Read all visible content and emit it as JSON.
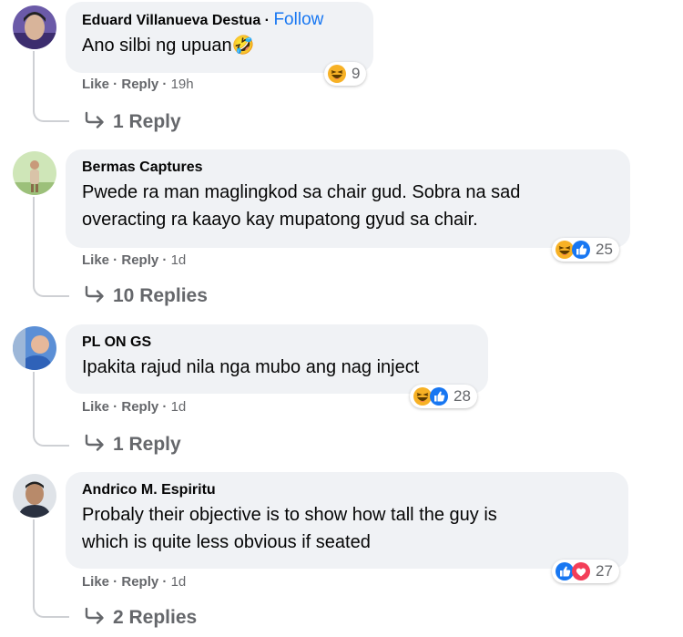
{
  "comments": [
    {
      "name": "Eduard Villanueva Destua",
      "separator": "·",
      "follow": "Follow",
      "text": "Ano silbi ng upuan🤣",
      "like": "Like",
      "reply": "Reply",
      "time": "19h",
      "reaction_icons": [
        "haha-icon"
      ],
      "reaction_count": "9",
      "replies": "1 Reply"
    },
    {
      "name": "Bermas Captures",
      "text": "Pwede ra man maglingkod sa chair gud. Sobra na sad\noveracting ra kaayo kay mupatong gyud sa chair.",
      "like": "Like",
      "reply": "Reply",
      "time": "1d",
      "reaction_icons": [
        "haha-icon",
        "like-icon"
      ],
      "reaction_count": "25",
      "replies": "10 Replies"
    },
    {
      "name": "PL ON GS",
      "text": "Ipakita rajud nila nga mubo ang nag inject",
      "like": "Like",
      "reply": "Reply",
      "time": "1d",
      "reaction_icons": [
        "haha-icon",
        "like-icon"
      ],
      "reaction_count": "28",
      "replies": "1 Reply"
    },
    {
      "name": "Andrico M. Espiritu",
      "text": "Probaly their objective is to show how tall the guy is\nwhich is quite less obvious if seated",
      "like": "Like",
      "reply": "Reply",
      "time": "1d",
      "reaction_icons": [
        "like-icon",
        "love-icon"
      ],
      "reaction_count": "27",
      "replies": "2 Replies"
    }
  ],
  "colors": {
    "bubble": "#f0f2f5",
    "link": "#1877f2",
    "meta": "#65676b",
    "like": "#1877f2",
    "love": "#f33e58",
    "haha": "#f7b125"
  }
}
